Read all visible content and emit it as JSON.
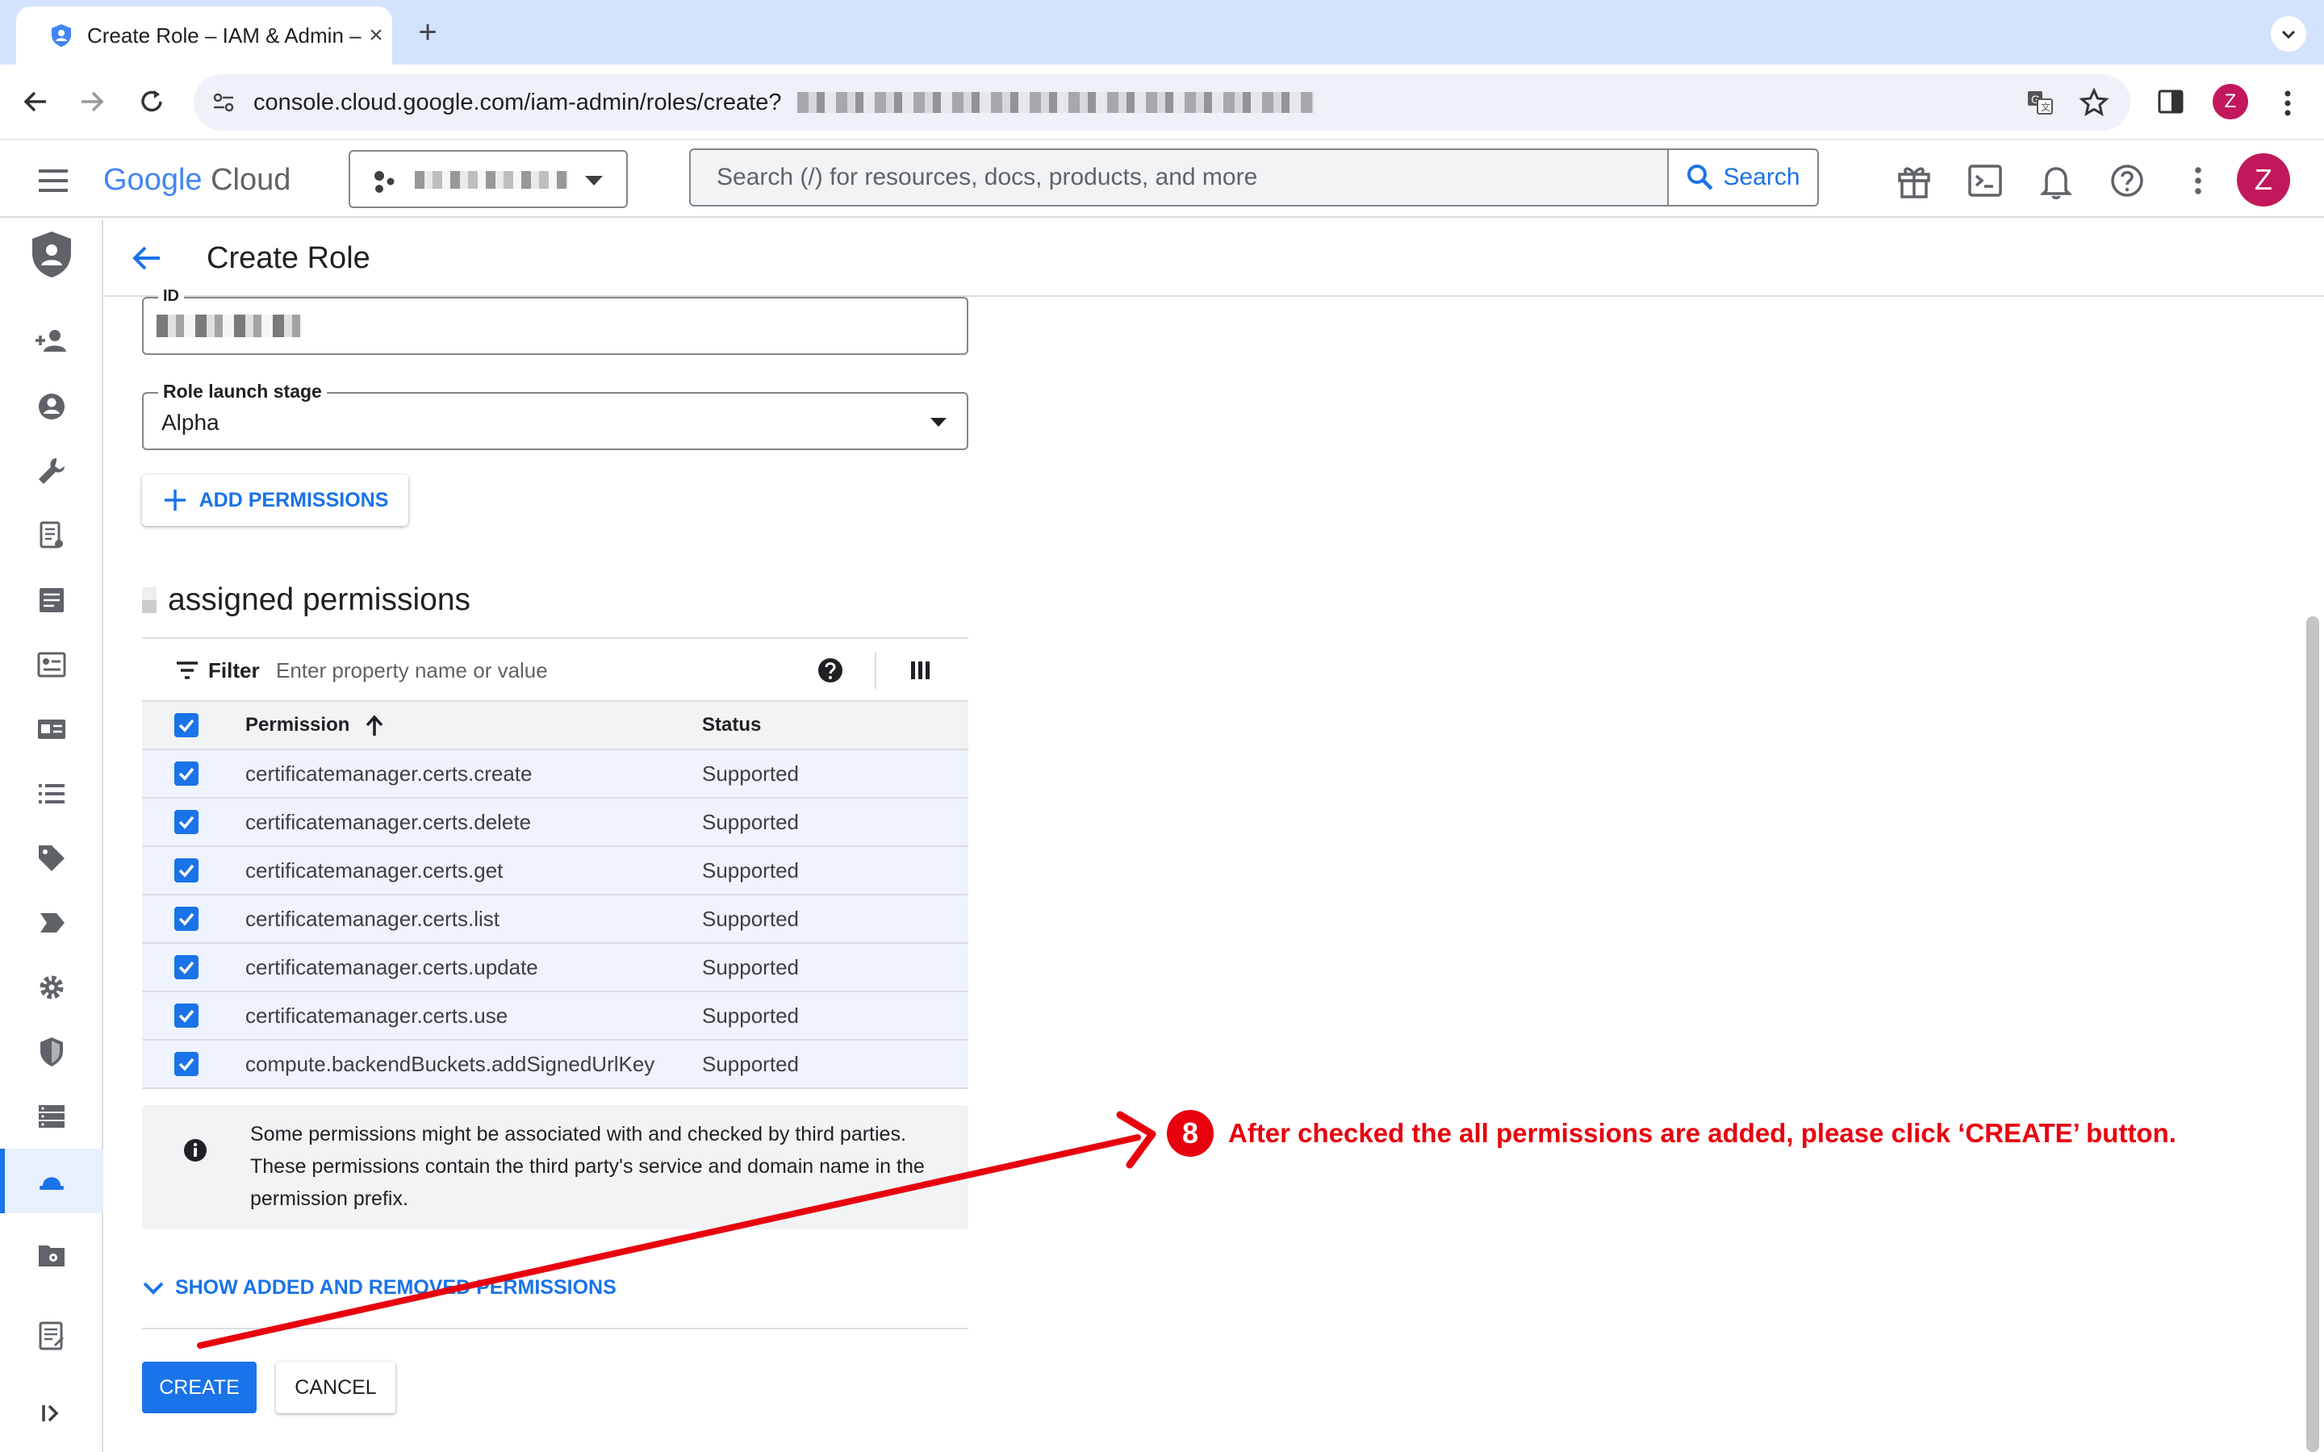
{
  "browser": {
    "tab_title": "Create Role – IAM & Admin –",
    "url": "console.cloud.google.com/iam-admin/roles/create?",
    "profile_initial": "Z"
  },
  "header": {
    "logo_google": "Google",
    "logo_cloud": "Cloud",
    "search_placeholder": "Search (/) for resources, docs, products, and more",
    "search_button": "Search",
    "avatar_initial": "Z"
  },
  "page": {
    "title": "Create Role"
  },
  "form": {
    "id_label": "ID",
    "launch_stage_label": "Role launch stage",
    "launch_stage_value": "Alpha",
    "add_permissions": "ADD PERMISSIONS",
    "assigned_title": "assigned permissions",
    "filter_label": "Filter",
    "filter_placeholder": "Enter property name or value"
  },
  "table": {
    "columns": [
      "Permission",
      "Status"
    ],
    "rows": [
      {
        "permission": "certificatemanager.certs.create",
        "status": "Supported"
      },
      {
        "permission": "certificatemanager.certs.delete",
        "status": "Supported"
      },
      {
        "permission": "certificatemanager.certs.get",
        "status": "Supported"
      },
      {
        "permission": "certificatemanager.certs.list",
        "status": "Supported"
      },
      {
        "permission": "certificatemanager.certs.update",
        "status": "Supported"
      },
      {
        "permission": "certificatemanager.certs.use",
        "status": "Supported"
      },
      {
        "permission": "compute.backendBuckets.addSignedUrlKey",
        "status": "Supported"
      }
    ]
  },
  "info": {
    "text": "Some permissions might be associated with and checked by third parties. These permissions contain the third party's service and domain name in the permission prefix."
  },
  "footer": {
    "show_added": "SHOW ADDED AND REMOVED PERMISSIONS",
    "create": "CREATE",
    "cancel": "CANCEL"
  },
  "annotation": {
    "step": "8",
    "text": "After checked the all permissions are added, please click ‘CREATE’ button.",
    "color": "#e8000d"
  },
  "colors": {
    "accent": "#1a73e8",
    "tabstrip": "#d3e3fd"
  }
}
